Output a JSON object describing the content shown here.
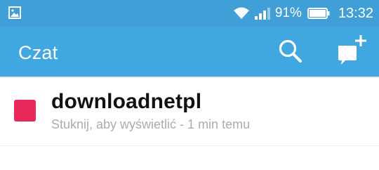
{
  "status_bar": {
    "battery_percent": "91%",
    "time": "13:32",
    "icons": [
      "gallery-icon",
      "wifi-icon",
      "signal-icon",
      "battery-icon"
    ]
  },
  "toolbar": {
    "title": "Czat",
    "icons": [
      "search-icon",
      "new-chat-icon"
    ]
  },
  "chats": [
    {
      "name": "downloadnetpl",
      "subtitle": "Stuknij, aby wyświetlić - 1 min temu",
      "indicator_color": "#e8275a"
    }
  ],
  "colors": {
    "toolbar": "#40a7e0",
    "status_bar": "#3f9fd6",
    "accent": "#e8275a"
  }
}
